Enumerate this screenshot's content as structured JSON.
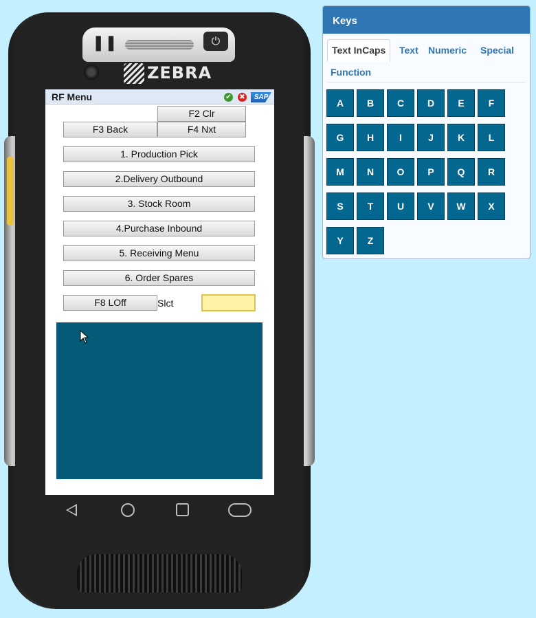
{
  "screen": {
    "title": "RF Menu",
    "icons": [
      "ok-icon",
      "cancel-icon",
      "sap-logo"
    ],
    "sap_logo_text": "SAP",
    "fkeys": {
      "f2": "F2 Clr",
      "f3": "F3 Back",
      "f4": "F4 Nxt",
      "f8": "F8 LOff"
    },
    "menu": [
      "1. Production Pick",
      "2.Delivery Outbound",
      "3. Stock Room",
      "4.Purchase Inbound",
      "5. Receiving Menu",
      "6. Order Spares"
    ],
    "select_label": "Slct",
    "select_value": "",
    "colors": {
      "output_bg": "#055a78",
      "input_bg": "#fff3a6",
      "titlebar_bg": "#dfe8f5"
    }
  },
  "device": {
    "brand": "ZEBRA",
    "nav": [
      "back-icon",
      "home-icon",
      "recents-icon",
      "pill-icon"
    ]
  },
  "keys_panel": {
    "title": "Keys",
    "tabs": [
      "Text InCaps",
      "Text",
      "Numeric",
      "Special",
      "Function"
    ],
    "active_tab": "Text InCaps",
    "keys": [
      "A",
      "B",
      "C",
      "D",
      "E",
      "F",
      "G",
      "H",
      "I",
      "J",
      "K",
      "L",
      "M",
      "N",
      "O",
      "P",
      "Q",
      "R",
      "S",
      "T",
      "U",
      "V",
      "W",
      "X",
      "Y",
      "Z"
    ],
    "colors": {
      "header_bg": "#2f76b4",
      "key_bg": "#04678f"
    }
  }
}
